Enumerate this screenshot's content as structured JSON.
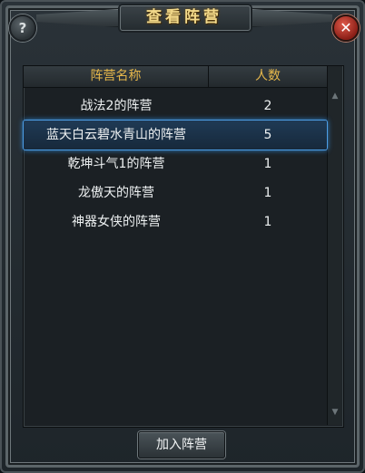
{
  "window": {
    "title": "查看阵营"
  },
  "table": {
    "headers": {
      "name": "阵营名称",
      "count": "人数"
    },
    "rows": [
      {
        "name": "战法2的阵营",
        "count": "2"
      },
      {
        "name": "蓝天白云碧水青山的阵营",
        "count": "5"
      },
      {
        "name": "乾坤斗气1的阵营",
        "count": "1"
      },
      {
        "name": "龙傲天的阵营",
        "count": "1"
      },
      {
        "name": "神器女侠的阵营",
        "count": "1"
      }
    ],
    "selected_index": 1
  },
  "buttons": {
    "join": "加入阵营",
    "help": "?",
    "close": "✕"
  },
  "scrollbar": {
    "up": "▲",
    "down": "▼"
  },
  "colors": {
    "title": "#f2d98a",
    "header_text": "#e7b84b",
    "selection_border": "#4d9ee6"
  },
  "icons": {
    "help": "help-icon",
    "close": "close-icon"
  }
}
